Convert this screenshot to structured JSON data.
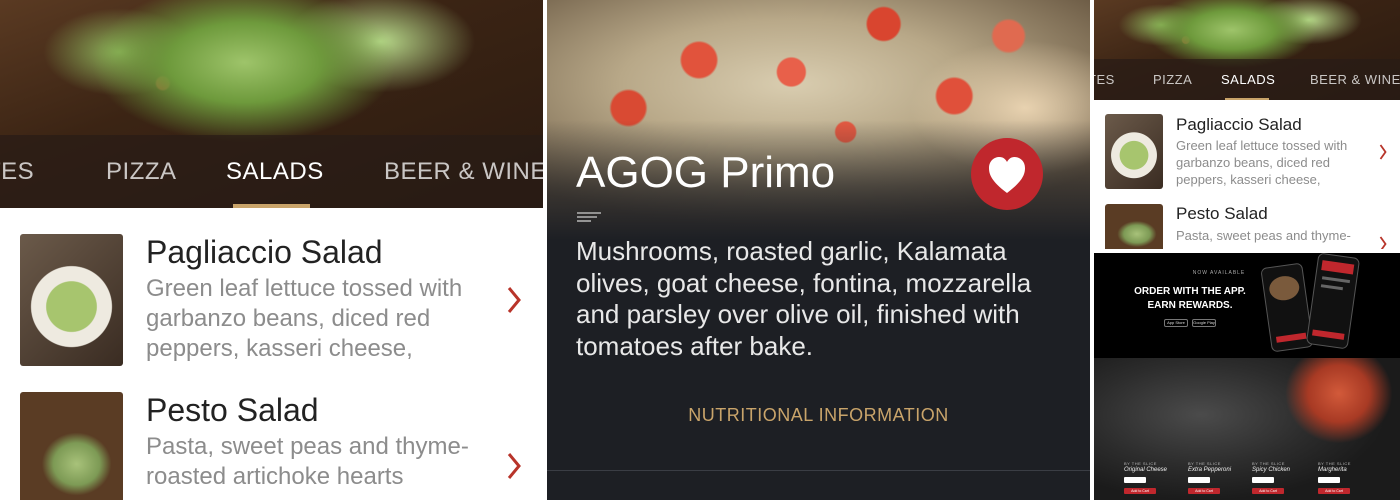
{
  "colors": {
    "accent_gold": "#c9a46a",
    "brand_red": "#c0272d",
    "dark_bg": "#1d1f24"
  },
  "salads_screen": {
    "tabs": [
      "TES",
      "PIZZA",
      "SALADS",
      "BEER & WINE"
    ],
    "active_tab": "SALADS",
    "items": [
      {
        "title": "Pagliaccio Salad",
        "description": "Green leaf lettuce tossed with garbanzo beans, diced red peppers, kasseri cheese, salami,…",
        "icon": "chevron-right-icon"
      },
      {
        "title": "Pesto Salad",
        "description": "Pasta, sweet peas and thyme-roasted artichoke hearts tossed",
        "icon": "chevron-right-icon"
      }
    ]
  },
  "pizza_detail": {
    "title": "AGOG Primo",
    "favorite_icon": "heart-icon",
    "description_icon": "menu-lines-icon",
    "description": "Mushrooms, roasted garlic, Kalamata olives, goat cheese, fontina, mozzarella and parsley over olive oil, finished with tomatoes after bake.",
    "nutrition_link": "NUTRITIONAL INFORMATION"
  },
  "salads_small": {
    "tabs": [
      "TES",
      "PIZZA",
      "SALADS",
      "BEER & WINE"
    ],
    "active_tab": "SALADS",
    "items": [
      {
        "title": "Pagliaccio Salad",
        "description": "Green leaf lettuce tossed with garbanzo beans, diced red peppers, kasseri cheese, salami,…"
      },
      {
        "title": "Pesto Salad",
        "description": "Pasta, sweet peas and thyme-"
      }
    ]
  },
  "promo": {
    "eyebrow": "NOW AVAILABLE",
    "headline": "ORDER WITH THE APP. EARN REWARDS.",
    "badges": [
      "App Store",
      "Google Play"
    ],
    "slices": [
      {
        "by": "BY THE SLICE",
        "name": "Original Cheese",
        "button": "Add to Cart"
      },
      {
        "by": "BY THE SLICE",
        "name": "Extra Pepperoni",
        "button": "Add to Cart"
      },
      {
        "by": "BY THE SLICE",
        "name": "Spicy Chicken",
        "button": "Add to Cart"
      },
      {
        "by": "BY THE SLICE",
        "name": "Margherita",
        "button": "Add to Cart"
      }
    ]
  }
}
